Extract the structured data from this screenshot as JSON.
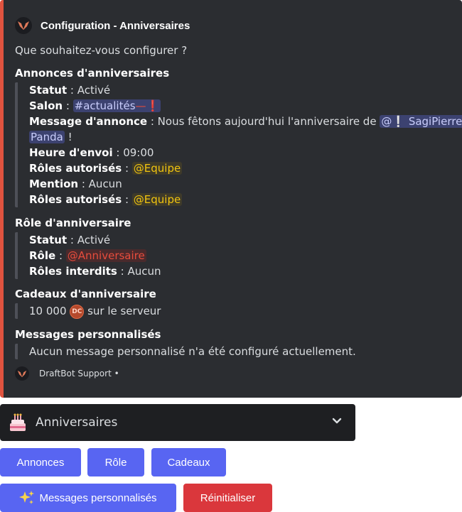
{
  "embed": {
    "accent_color": "#e0533f",
    "author": "Configuration - Anniversaires",
    "description": "Que souhaitez-vous configurer ?",
    "fields": {
      "announcements": {
        "title": "Annonces d'anniversaires",
        "status_key": "Statut",
        "status_val": "Activé",
        "channel_key": "Salon",
        "channel_mention": "#actualités",
        "channel_emoji": "—❗",
        "message_key": "Message d'annonce",
        "message_text": "Nous fêtons aujourd'hui l'anniversaire de",
        "user_mention_prefix": "@❕",
        "user_mention_1": "SagiPierre -",
        "user_mention_2": "Panda",
        "message_end": "!",
        "time_key": "Heure d'envoi",
        "time_val": "09:00",
        "roles_key": "Rôles autorisés",
        "roles_val": "@Equipe",
        "mention_key": "Mention",
        "mention_val": "Aucun",
        "roles2_key": "Rôles autorisés",
        "roles2_val": "@Equipe"
      },
      "role": {
        "title": "Rôle d'anniversaire",
        "status_key": "Statut",
        "status_val": "Activé",
        "role_key": "Rôle",
        "role_val": "@Anniversaire",
        "forbidden_key": "Rôles interdits",
        "forbidden_val": "Aucun"
      },
      "gifts": {
        "title": "Cadeaux d'anniversaire",
        "amount": "10 000",
        "coin_icon": "DC",
        "suffix": "sur le serveur"
      },
      "custom": {
        "title": "Messages personnalisés",
        "text": "Aucun message personnalisé n'a été configuré actuellement."
      }
    },
    "footer": "DraftBot Support •"
  },
  "select": {
    "label": "Anniversaires",
    "icon": "cake-icon"
  },
  "buttons": {
    "announces": "Annonces",
    "role": "Rôle",
    "gifts": "Cadeaux",
    "custom_messages": "Messages personnalisés",
    "reset": "Réinitialiser"
  },
  "colors": {
    "blurple": "#5865f2",
    "danger": "#da373c",
    "embed_bg": "#2b2d31"
  }
}
